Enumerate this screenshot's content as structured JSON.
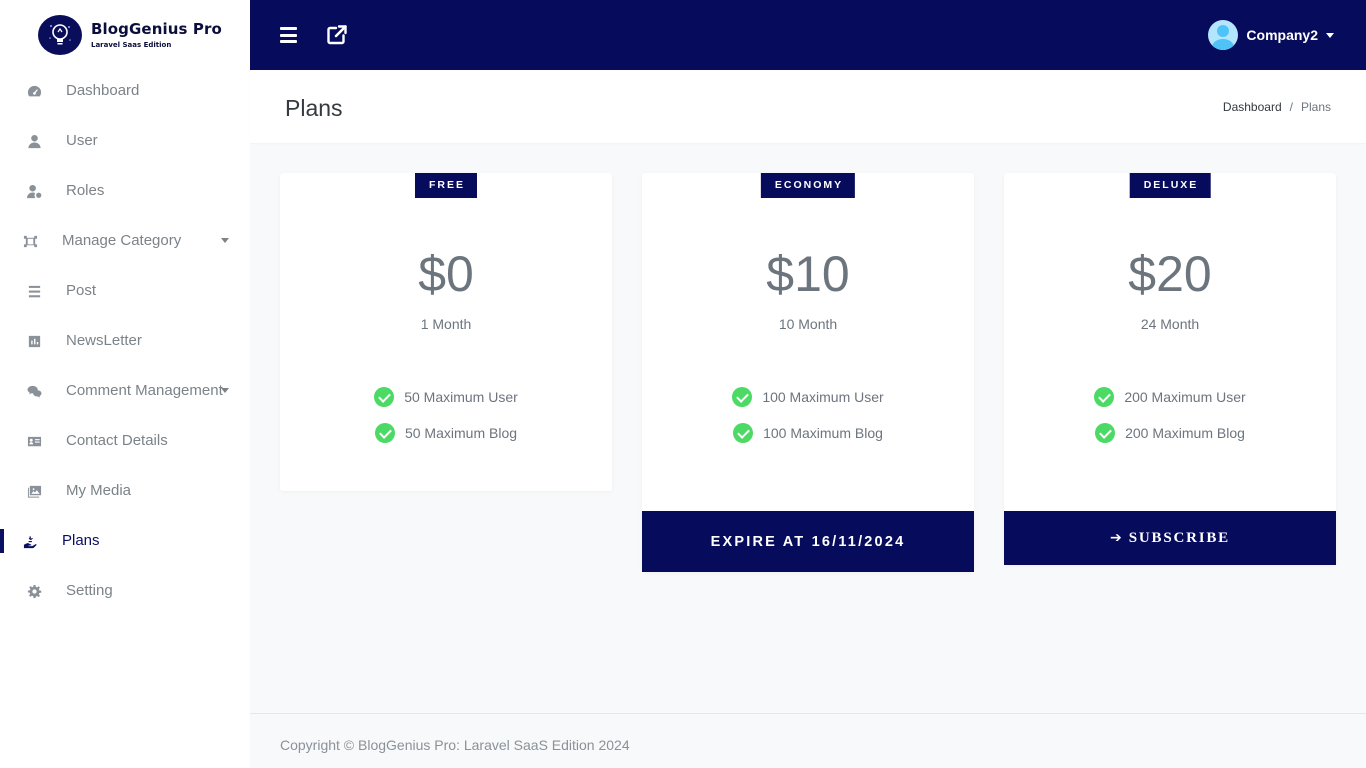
{
  "brand": {
    "title": "BlogGenius Pro",
    "subtitle": "Laravel Saas Edition"
  },
  "sidebar": {
    "items": [
      {
        "label": "Dashboard",
        "icon": "gauge-icon"
      },
      {
        "label": "User",
        "icon": "user-icon"
      },
      {
        "label": "Roles",
        "icon": "user-cog-icon"
      },
      {
        "label": "Manage Category",
        "icon": "category-icon",
        "has_caret": true
      },
      {
        "label": "Post",
        "icon": "list-icon"
      },
      {
        "label": "NewsLetter",
        "icon": "chart-icon"
      },
      {
        "label": "Comment Management",
        "icon": "comments-icon",
        "has_caret": true
      },
      {
        "label": "Contact Details",
        "icon": "id-card-icon"
      },
      {
        "label": "My Media",
        "icon": "images-icon"
      },
      {
        "label": "Plans",
        "icon": "hand-holding-icon",
        "active": true
      },
      {
        "label": "Setting",
        "icon": "gear-icon"
      }
    ]
  },
  "topbar": {
    "user_name": "Company2"
  },
  "page": {
    "title": "Plans"
  },
  "breadcrumb": {
    "home": "Dashboard",
    "separator": "/",
    "current": "Plans"
  },
  "plans": [
    {
      "badge": "FREE",
      "price": "$0",
      "duration": "1 Month",
      "features": [
        "50 Maximum User",
        "50 Maximum Blog"
      ]
    },
    {
      "badge": "ECONOMY",
      "price": "$10",
      "duration": "10 Month",
      "features": [
        "100 Maximum User",
        "100 Maximum Blog"
      ],
      "button": "EXPIRE AT 16/11/2024"
    },
    {
      "badge": "DELUXE",
      "price": "$20",
      "duration": "24 Month",
      "features": [
        "200 Maximum User",
        "200 Maximum Blog"
      ],
      "button": "SUBSCRIBE"
    }
  ],
  "footer": {
    "text": "Copyright © BlogGenius Pro: Laravel SaaS Edition 2024"
  },
  "colors": {
    "primary": "#070b5c",
    "check": "#4cd964",
    "muted": "#6c757d"
  }
}
